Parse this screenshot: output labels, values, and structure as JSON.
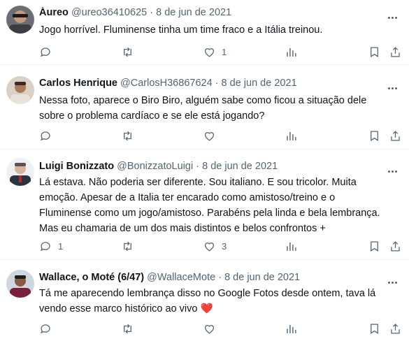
{
  "tweets": [
    {
      "name": "Áureo",
      "handle": "@ureo36410625",
      "date": "8 de jun de 2021",
      "text": [
        "Jogo horrível. Fluminense tinha um time fraco e a Itália treinou."
      ],
      "replies": "",
      "likes": "1"
    },
    {
      "name": "Carlos Henrique",
      "handle": "@CarlosH36867624",
      "date": "8 de jun de 2021",
      "text": [
        "Nessa foto, aparece o Biro Biro, alguém sabe como ficou a situação dele",
        "sobre o problema cardíaco e se ele está jogando?"
      ],
      "replies": "",
      "likes": ""
    },
    {
      "name": "Luigi Bonizzato",
      "handle": "@BonizzatoLuigi",
      "date": "8 de jun de 2021",
      "text": [
        "Lá estava. Não poderia ser diferente. Sou italiano. E sou tricolor. Muita",
        "emoção. Apesar de a Italia ter encarado como amistoso/treino e o",
        "Fluminense como um jogo/amistoso. Parabéns pela linda e bela lembrança.",
        "Mas eu chamaria de um dos mais distintos e belos confrontos +"
      ],
      "replies": "1",
      "likes": "3"
    },
    {
      "name": "Wallace, o Moté (6/47)",
      "handle": "@WallaceMote",
      "date": "8 de jun de 2021",
      "text": [
        "Tá me aparecendo lembrança disso no Google Fotos desde ontem, tava lá",
        "vendo esse marco histórico ao vivo"
      ],
      "replies": "",
      "likes": ""
    }
  ],
  "separator": "·",
  "emoji": "❤️",
  "icons": {
    "reply": "reply-icon",
    "retweet": "retweet-icon",
    "like": "heart-outline-icon",
    "views": "analytics-icon",
    "bookmark": "bookmark-icon",
    "share": "share-icon",
    "more": "more-icon"
  },
  "colors": {
    "name": "#0f1419",
    "meta": "#536471",
    "divider": "#eff3f4",
    "heart_emoji": "#e0245e"
  }
}
